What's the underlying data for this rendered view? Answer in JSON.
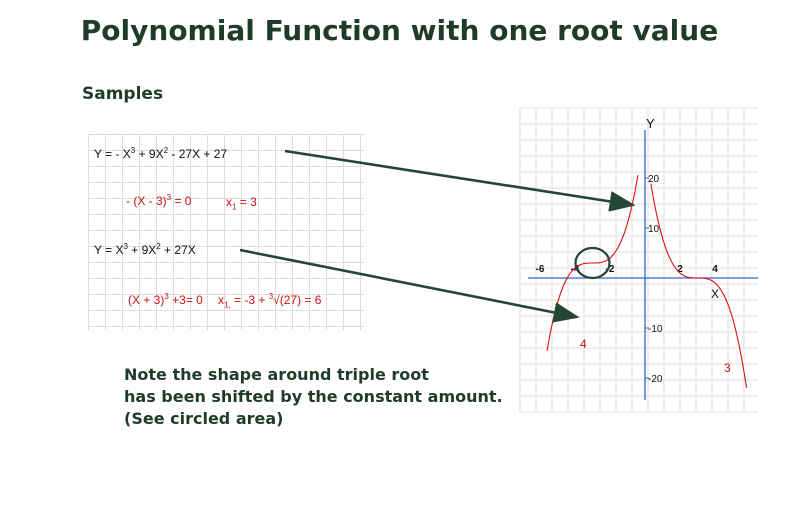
{
  "title": "Polynomial Function with one root value",
  "samples_label": "Samples",
  "equations": {
    "eq1_a": "Y = - X",
    "eq1_a_sup": "3",
    "eq1_b": " + 9X",
    "eq1_b_sup": "2",
    "eq1_c": " - 27X + 27",
    "res1_a": "- (X - 3)",
    "res1_a_sup": "3",
    "res1_b": " = 0",
    "res1_root_a": "x",
    "res1_root_sub": "1",
    "res1_root_b": " = 3",
    "eq2_a": "Y = X",
    "eq2_a_sup": "3",
    "eq2_b": " + 9X",
    "eq2_b_sup": "2",
    "eq2_c": " + 27X",
    "res2_a": "(X + 3)",
    "res2_a_sup": "3",
    "res2_b": " +3= 0",
    "res2_root_a": "x",
    "res2_root_sub": "1,",
    "res2_root_b": " = -3 + ",
    "res2_root_sup": "3",
    "res2_root_c": "√(27) = 6"
  },
  "note_lines": [
    "Note the shape around triple root",
    "has been shifted by the constant amount.",
    "(See circled area)"
  ],
  "chart_data": {
    "type": "line",
    "xlabel": "X",
    "ylabel": "Y",
    "x_ticks": [
      "-6",
      "-4",
      "-2",
      "2",
      "4"
    ],
    "y_ticks": [
      "20",
      "10",
      "-10",
      "-20"
    ],
    "curve_labels": [
      "4",
      "3"
    ],
    "xlim": [
      -7,
      7
    ],
    "ylim": [
      -26,
      32
    ],
    "grid": true,
    "series": [
      {
        "label": "3",
        "x": [
          0.34,
          1,
          2,
          2.5,
          3,
          3.5,
          4,
          5,
          5.8
        ],
        "y": [
          21.9,
          8,
          1,
          0.125,
          0,
          -0.125,
          -1,
          -8,
          -22
        ]
      },
      {
        "label": "4",
        "x": [
          -5.6,
          -5,
          -4,
          -3.5,
          -3,
          -2.5,
          -2,
          -1,
          -0.4
        ],
        "y": [
          -14.6,
          -5,
          2,
          2.875,
          3,
          3.125,
          4,
          11,
          20.3
        ]
      }
    ],
    "colors": {
      "curve": "#dd1111",
      "axis": "#3366cc",
      "arrow": "#254535",
      "circle": "#254535"
    }
  }
}
